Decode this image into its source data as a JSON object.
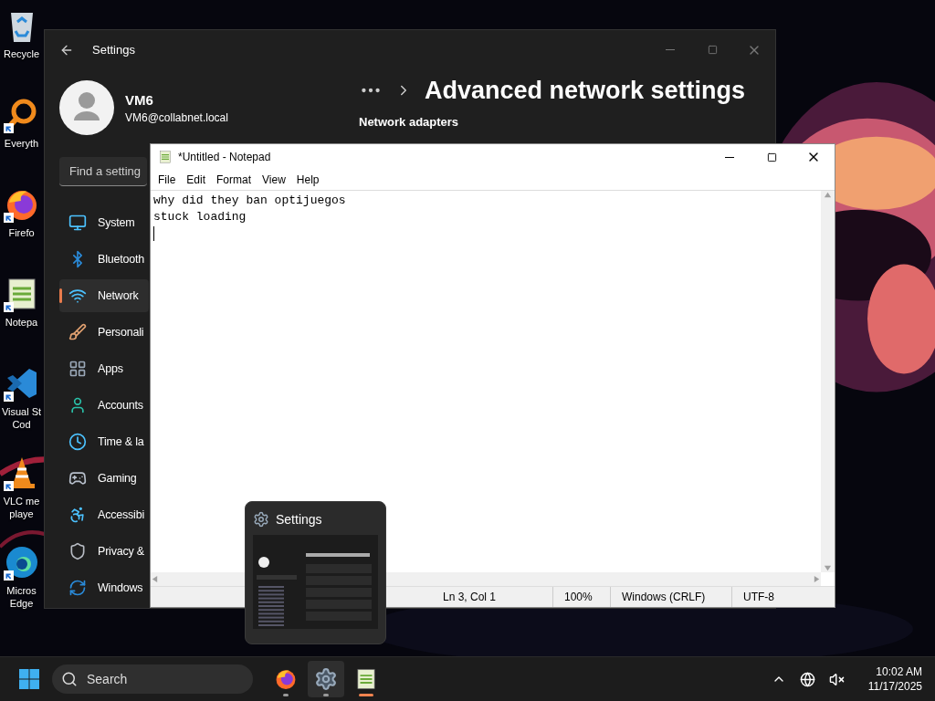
{
  "desktop_icons": [
    {
      "kind": "recycle",
      "label": "Recycle",
      "shortcut": false
    },
    {
      "kind": "search-app",
      "label": "Everyth",
      "shortcut": true
    },
    {
      "kind": "firefox",
      "label": "Firefo",
      "shortcut": true
    },
    {
      "kind": "notepad",
      "label": "Notepa",
      "shortcut": true
    },
    {
      "kind": "vscode",
      "label": "Visual St\nCod",
      "shortcut": true
    },
    {
      "kind": "vlc",
      "label": "VLC me\nplaye",
      "shortcut": true
    },
    {
      "kind": "edge",
      "label": "Micros\nEdge",
      "shortcut": true
    }
  ],
  "settings": {
    "title": "Settings",
    "user": {
      "name": "VM6",
      "email": "VM6@collabnet.local"
    },
    "search": {
      "placeholder": "Find a setting"
    },
    "nav": [
      {
        "kind": "system",
        "label": "System",
        "selected": false
      },
      {
        "kind": "bluetooth",
        "label": "Bluetooth",
        "selected": false
      },
      {
        "kind": "network",
        "label": "Network",
        "selected": true
      },
      {
        "kind": "personalization",
        "label": "Personali",
        "selected": false
      },
      {
        "kind": "apps",
        "label": "Apps",
        "selected": false
      },
      {
        "kind": "accounts",
        "label": "Accounts",
        "selected": false
      },
      {
        "kind": "time",
        "label": "Time & la",
        "selected": false
      },
      {
        "kind": "gaming",
        "label": "Gaming",
        "selected": false
      },
      {
        "kind": "accessibility",
        "label": "Accessibi",
        "selected": false
      },
      {
        "kind": "privacy",
        "label": "Privacy &",
        "selected": false
      },
      {
        "kind": "update",
        "label": "Windows",
        "selected": false
      }
    ],
    "page_title": "Advanced network settings",
    "section": "Network adapters"
  },
  "notepad": {
    "title": "*Untitled - Notepad",
    "menu": [
      "File",
      "Edit",
      "Format",
      "View",
      "Help"
    ],
    "lines": [
      "why did they ban optijuegos",
      "stuck loading"
    ],
    "status": {
      "position": "Ln 3, Col 1",
      "zoom": "100%",
      "line_ending": "Windows (CRLF)",
      "encoding": "UTF-8"
    }
  },
  "thumbnail": {
    "title": "Settings"
  },
  "taskbar": {
    "search": {
      "placeholder": "Search"
    },
    "apps": [
      {
        "kind": "firefox",
        "hovered": false,
        "active": false
      },
      {
        "kind": "settings",
        "hovered": true,
        "active": false
      },
      {
        "kind": "notepad",
        "hovered": false,
        "active": true
      }
    ],
    "clock": {
      "time": "10:02 AM",
      "date": "11/17/2025"
    }
  }
}
